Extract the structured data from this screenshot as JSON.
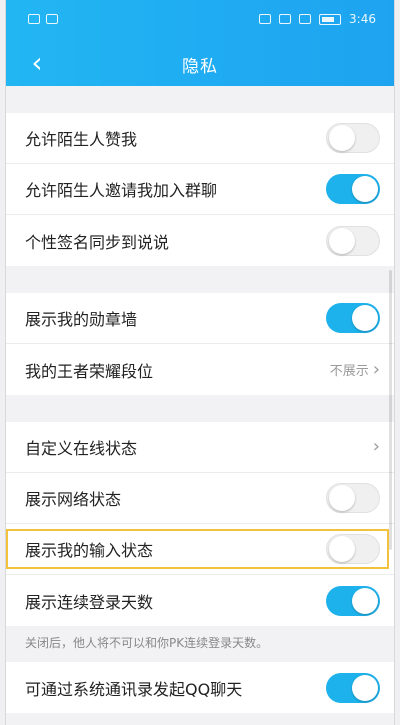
{
  "status_bar": {
    "time": "3:46"
  },
  "header": {
    "title": "隐私",
    "back_icon": "back-arrow-icon"
  },
  "colors": {
    "header": "#1ea3f0",
    "toggle_on": "#1eb2ec",
    "highlight": "#f3c23d"
  },
  "groups": [
    {
      "rows": [
        {
          "label": "允许陌生人赞我",
          "toggle": false
        },
        {
          "label": "允许陌生人邀请我加入群聊",
          "toggle": true
        },
        {
          "label": "个性签名同步到说说",
          "toggle": false
        }
      ]
    },
    {
      "rows": [
        {
          "label": "展示我的勋章墙",
          "toggle": true
        },
        {
          "label": "我的王者荣耀段位",
          "value": "不展示"
        }
      ]
    },
    {
      "rows": [
        {
          "label": "自定义在线状态"
        },
        {
          "label": "展示网络状态",
          "toggle": false
        },
        {
          "label": "展示我的输入状态",
          "toggle": false
        },
        {
          "label": "展示连续登录天数",
          "toggle": true
        }
      ],
      "hint": "关闭后，他人将不可以和你PK连续登录天数。"
    },
    {
      "rows": [
        {
          "label": "可通过系统通讯录发起QQ聊天",
          "toggle": true
        }
      ]
    }
  ]
}
